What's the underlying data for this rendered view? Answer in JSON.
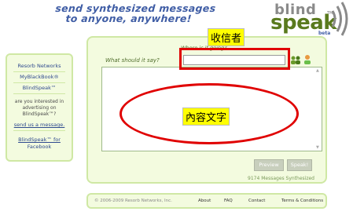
{
  "header": {
    "tagline_line1": "send synthesized messages",
    "tagline_line2": "to anyone, anywhere!",
    "logo_top": "blind",
    "logo_main": "speak",
    "logo_beta": "beta",
    "logo_tm": "TM"
  },
  "sidebar": {
    "links": [
      "Resorb Networks",
      "MyBlackBook®",
      "BlindSpeak™"
    ],
    "advertising_text": [
      "are you interested in",
      "advertising on",
      "BlindSpeak™?"
    ],
    "send_message": "send us a message.",
    "facebook_line1": "BlindSpeak™ for",
    "facebook_line2": "Facebook"
  },
  "form": {
    "where_label": "Where is it going?",
    "what_label": "What should it say?",
    "recipient_value": "",
    "message_value": ""
  },
  "buttons": {
    "preview": "Preview",
    "speak": "Speak!"
  },
  "stats": {
    "messages_synthesized": "9174 Messages Synthesized"
  },
  "annotations": {
    "recipient_label": "收信者",
    "message_label": "內容文字",
    "highlight_color": "#e00000",
    "label_bg": "#ffff00"
  },
  "footer": {
    "copyright": "© 2006-2009 Resorb Networks, Inc.",
    "links": [
      "About",
      "FAQ",
      "Contact",
      "Terms & Conditions"
    ]
  },
  "colors": {
    "panel_bg": "#f3fbdf",
    "panel_border": "#cfe8a4",
    "brand_blue": "#3f5da5",
    "brand_green": "#5a7a1e"
  }
}
